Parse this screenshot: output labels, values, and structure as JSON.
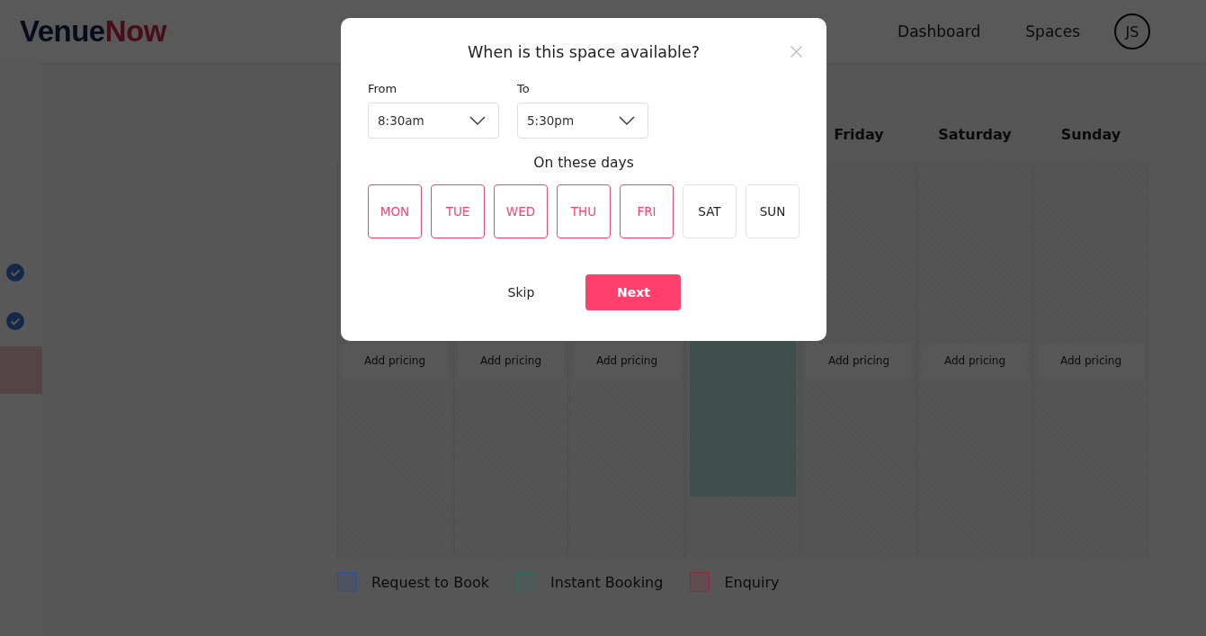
{
  "header": {
    "logo": {
      "first": "Venue",
      "second": "Now"
    },
    "nav": [
      {
        "label": "Dashboard"
      },
      {
        "label": "Spaces"
      }
    ],
    "avatar": "JS"
  },
  "calendar": {
    "columns": [
      {
        "kind": "pricing",
        "button": "Add pricing"
      },
      {
        "kind": "pricing",
        "button": "Add pricing"
      },
      {
        "kind": "pricing",
        "button": "Add pricing"
      },
      {
        "kind": "instant"
      },
      {
        "kind": "pricing",
        "heading": "Friday",
        "button": "Add pricing"
      },
      {
        "kind": "pricing",
        "heading": "Saturday",
        "button": "Add pricing"
      },
      {
        "kind": "pricing",
        "heading": "Sunday",
        "button": "Add pricing"
      }
    ]
  },
  "legend": [
    {
      "label": "Request to Book",
      "color": "#2d4f8f"
    },
    {
      "label": "Instant Booking",
      "color": "#2e6e60"
    },
    {
      "label": "Enquiry",
      "color": "#8a2a40"
    }
  ],
  "modal": {
    "title": "When is this space available?",
    "from": {
      "label": "From",
      "value": "8:30am"
    },
    "to": {
      "label": "To",
      "value": "5:30pm"
    },
    "days_label": "On these days",
    "days": [
      {
        "label": "MON",
        "selected": true
      },
      {
        "label": "TUE",
        "selected": true
      },
      {
        "label": "WED",
        "selected": true
      },
      {
        "label": "THU",
        "selected": true
      },
      {
        "label": "FRI",
        "selected": true
      },
      {
        "label": "SAT",
        "selected": false
      },
      {
        "label": "SUN",
        "selected": false
      }
    ],
    "skip": "Skip",
    "next": "Next"
  }
}
